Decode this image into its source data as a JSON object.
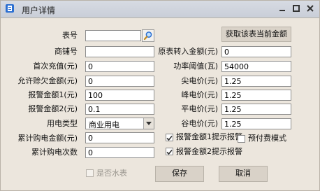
{
  "window": {
    "title": "用户详情",
    "controls": [
      "minimize-icon",
      "maximize-icon",
      "close-icon"
    ]
  },
  "fields": {
    "meter_no": {
      "label": "表号",
      "value": ""
    },
    "shop_no": {
      "label": "商铺号",
      "value": ""
    },
    "first_recharge": {
      "label": "首次充值(元)",
      "value": "0"
    },
    "overdraft": {
      "label": "允许赊欠金额(元)",
      "value": "0"
    },
    "alarm1": {
      "label": "报警金额1(元)",
      "value": "100"
    },
    "alarm2": {
      "label": "报警金额2(元)",
      "value": "0.1"
    },
    "usage_type": {
      "label": "用电类型",
      "value": "商业用电"
    },
    "total_purchase_amount": {
      "label": "累计购电金额(元)",
      "value": "0"
    },
    "total_purchase_times": {
      "label": "累计购电次数",
      "value": "0"
    },
    "transfer_amount": {
      "label": "原表转入金额(元)",
      "value": "0"
    },
    "power_threshold": {
      "label": "功率阈值(瓦)",
      "value": "54000"
    },
    "sharp_price": {
      "label": "尖电价(元)",
      "value": "1.25"
    },
    "peak_price": {
      "label": "峰电价(元)",
      "value": "1.25"
    },
    "flat_price": {
      "label": "平电价(元)",
      "value": "1.25"
    },
    "valley_price": {
      "label": "谷电价(元)",
      "value": "1.25"
    }
  },
  "checkboxes": {
    "alarm1_prompt": {
      "label": "报警金额1提示报警",
      "checked": true
    },
    "alarm2_prompt": {
      "label": "报警金额2提示报警",
      "checked": true
    },
    "prepay_mode": {
      "label": "预付费模式",
      "checked": false
    },
    "water_meter": {
      "label": "是否水表",
      "checked": false
    }
  },
  "buttons": {
    "get_amount": "获取该表当前金额",
    "save": "保存",
    "cancel": "取消"
  },
  "colors": {
    "background": "#ece6dd",
    "titlebar": "#cfd4dd",
    "accent_icon": "#2c6fd1"
  }
}
